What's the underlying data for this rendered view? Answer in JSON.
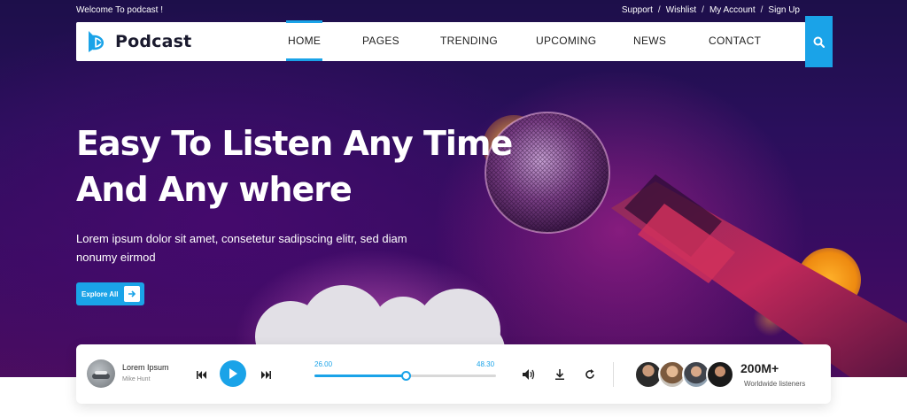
{
  "topbar": {
    "welcome": "Welcome To podcast !",
    "links": [
      "Support",
      "Wishlist",
      "My Account",
      "Sign Up"
    ],
    "separator": "/"
  },
  "brand": {
    "name": "Podcast",
    "accent": "#1aa3e8"
  },
  "nav": {
    "items": [
      {
        "label": "HOME",
        "active": true
      },
      {
        "label": "PAGES",
        "active": false
      },
      {
        "label": "TRENDING",
        "active": false
      },
      {
        "label": "UPCOMING",
        "active": false
      },
      {
        "label": "NEWS",
        "active": false
      },
      {
        "label": "CONTACT",
        "active": false
      }
    ],
    "search_icon": "search-icon"
  },
  "hero": {
    "title_line1": "Easy To Listen Any Time",
    "title_line2": "And Any where",
    "subtitle": "Lorem ipsum dolor sit amet, consetetur sadipscing elitr, sed diam nonumy eirmod",
    "cta_label": "Explore All",
    "cta_icon": "arrow-right-icon"
  },
  "player": {
    "track_title": "Lorem Ipsum",
    "artist": "Mike Hunt",
    "elapsed": "26.00",
    "duration": "48.30",
    "progress_fraction": 0.5,
    "icons": [
      "previous-icon",
      "play-icon",
      "next-icon",
      "volume-icon",
      "download-icon",
      "repeat-icon"
    ],
    "listener_count": "200M+",
    "listener_label": "Worldwide listeners"
  }
}
